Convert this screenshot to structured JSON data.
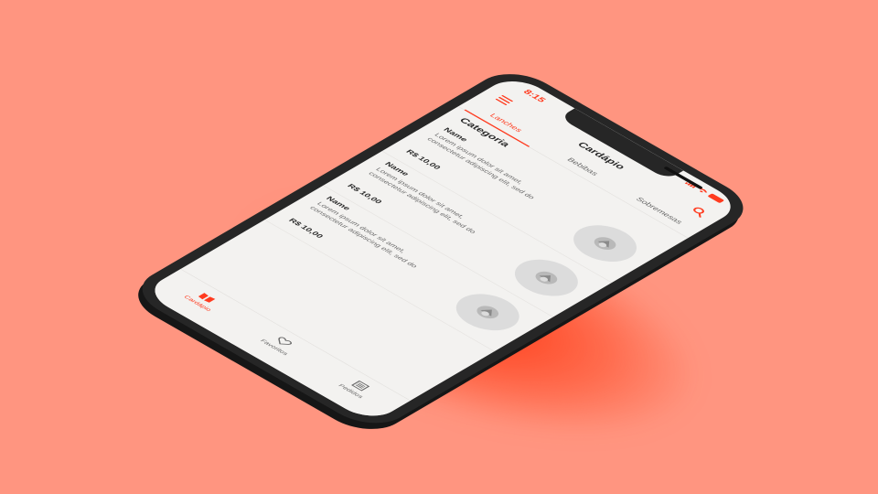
{
  "status_bar": {
    "time": "8:15"
  },
  "header": {
    "title": "Cardápio",
    "menu_icon": "hamburger-icon",
    "search_icon": "search-icon"
  },
  "tabs": [
    {
      "label": "Lanches",
      "active": true
    },
    {
      "label": "Bebibas",
      "active": false
    },
    {
      "label": "Sobremesas",
      "active": false
    }
  ],
  "section": {
    "title": "Categoria"
  },
  "items": [
    {
      "name": "Name",
      "description": "Lorem ipsum dolor sit amet, consectetur adipiscing elit, sed do",
      "price": "R$ 10,00"
    },
    {
      "name": "Name",
      "description": "Lorem ipsum dolor sit amet, consectetur adipiscing elit, sed do",
      "price": "R$ 10,00"
    },
    {
      "name": "Name",
      "description": "Lorem ipsum dolor sit amet, consectetur adipiscing elit, sed do",
      "price": "R$ 10,00"
    }
  ],
  "bottom_nav": [
    {
      "label": "Cardápio",
      "icon": "menu-book-icon",
      "active": true
    },
    {
      "label": "Favoritos",
      "icon": "heart-icon",
      "active": false
    },
    {
      "label": "Pedidos",
      "icon": "list-icon",
      "active": false
    }
  ],
  "colors": {
    "background": "#ff9580",
    "accent": "#ff3b1f",
    "device": "#262626",
    "screen": "#f3f2f0"
  }
}
